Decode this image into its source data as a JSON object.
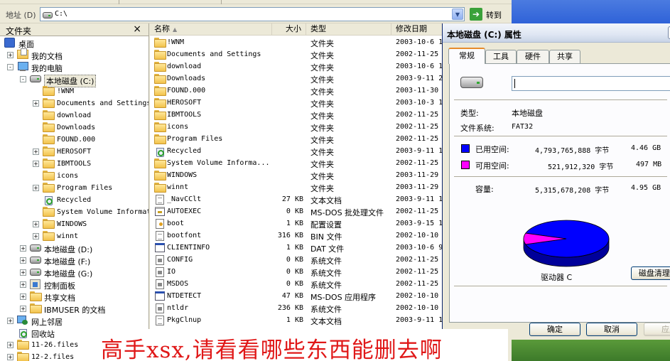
{
  "address_bar": {
    "label": "地址 (D)",
    "path": "C:\\",
    "go_label": "转到"
  },
  "folder_pane": {
    "title": "文件夹",
    "close": "×",
    "tree": [
      {
        "label": "桌面",
        "icon": "desktop-icon",
        "indent": 0,
        "exp": ""
      },
      {
        "label": "我的文档",
        "icon": "my-documents-icon",
        "indent": 1,
        "exp": "+"
      },
      {
        "label": "我的电脑",
        "icon": "my-computer-icon",
        "indent": 1,
        "exp": "-"
      },
      {
        "label": "本地磁盘 (C:)",
        "icon": "drive-icon",
        "indent": 2,
        "exp": "-",
        "selected": true
      },
      {
        "label": "!WNM",
        "icon": "folder-icon",
        "indent": 3,
        "exp": "",
        "mono": true
      },
      {
        "label": "Documents and Settings",
        "icon": "folder-icon",
        "indent": 3,
        "exp": "+",
        "mono": true
      },
      {
        "label": "download",
        "icon": "folder-icon",
        "indent": 3,
        "exp": "",
        "mono": true
      },
      {
        "label": "Downloads",
        "icon": "folder-icon",
        "indent": 3,
        "exp": "",
        "mono": true
      },
      {
        "label": "FOUND.000",
        "icon": "folder-icon",
        "indent": 3,
        "exp": "",
        "mono": true
      },
      {
        "label": "HEROSOFT",
        "icon": "folder-icon",
        "indent": 3,
        "exp": "+",
        "mono": true
      },
      {
        "label": "IBMTOOLS",
        "icon": "folder-icon",
        "indent": 3,
        "exp": "+",
        "mono": true
      },
      {
        "label": "icons",
        "icon": "folder-icon",
        "indent": 3,
        "exp": "",
        "mono": true
      },
      {
        "label": "Program Files",
        "icon": "folder-icon",
        "indent": 3,
        "exp": "+",
        "mono": true
      },
      {
        "label": "Recycled",
        "icon": "recycle-bin-icon",
        "indent": 3,
        "exp": "",
        "mono": true
      },
      {
        "label": "System Volume Information",
        "icon": "folder-icon",
        "indent": 3,
        "exp": "",
        "mono": true
      },
      {
        "label": "WINDOWS",
        "icon": "folder-icon",
        "indent": 3,
        "exp": "+",
        "mono": true
      },
      {
        "label": "winnt",
        "icon": "folder-icon",
        "indent": 3,
        "exp": "+",
        "mono": true
      },
      {
        "label": "本地磁盘 (D:)",
        "icon": "drive-icon",
        "indent": 2,
        "exp": "+"
      },
      {
        "label": "本地磁盘 (F:)",
        "icon": "drive-icon",
        "indent": 2,
        "exp": "+"
      },
      {
        "label": "本地磁盘 (G:)",
        "icon": "drive-icon",
        "indent": 2,
        "exp": "+"
      },
      {
        "label": "控制面板",
        "icon": "control-panel-icon",
        "indent": 2,
        "exp": "+"
      },
      {
        "label": "共享文档",
        "icon": "folder-icon",
        "indent": 2,
        "exp": "+"
      },
      {
        "label": "IBMUSER 的文档",
        "icon": "folder-icon",
        "indent": 2,
        "exp": "+"
      },
      {
        "label": "网上邻居",
        "icon": "network-icon",
        "indent": 1,
        "exp": "+"
      },
      {
        "label": "回收站",
        "icon": "recycle-bin-icon",
        "indent": 1,
        "exp": ""
      },
      {
        "label": "11-26.files",
        "icon": "folder-icon",
        "indent": 1,
        "exp": "+",
        "mono": true
      },
      {
        "label": "12-2.files",
        "icon": "folder-icon",
        "indent": 1,
        "exp": "+",
        "mono": true
      }
    ]
  },
  "file_list": {
    "columns": {
      "name": "名称",
      "size": "大小",
      "type": "类型",
      "date": "修改日期"
    },
    "rows": [
      {
        "name": "!WNM",
        "size": "",
        "type": "文件夹",
        "date": "2003-10-6 1",
        "icon": "folder-icon"
      },
      {
        "name": "Documents and Settings",
        "size": "",
        "type": "文件夹",
        "date": "2002-11-25",
        "icon": "folder-icon"
      },
      {
        "name": "download",
        "size": "",
        "type": "文件夹",
        "date": "2003-10-6 1",
        "icon": "folder-icon"
      },
      {
        "name": "Downloads",
        "size": "",
        "type": "文件夹",
        "date": "2003-9-11 2",
        "icon": "folder-icon"
      },
      {
        "name": "FOUND.000",
        "size": "",
        "type": "文件夹",
        "date": "2003-11-30",
        "icon": "folder-icon"
      },
      {
        "name": "HEROSOFT",
        "size": "",
        "type": "文件夹",
        "date": "2003-10-3 1",
        "icon": "folder-icon"
      },
      {
        "name": "IBMTOOLS",
        "size": "",
        "type": "文件夹",
        "date": "2002-11-25",
        "icon": "folder-icon"
      },
      {
        "name": "icons",
        "size": "",
        "type": "文件夹",
        "date": "2002-11-25",
        "icon": "folder-icon"
      },
      {
        "name": "Program Files",
        "size": "",
        "type": "文件夹",
        "date": "2002-11-25",
        "icon": "folder-icon"
      },
      {
        "name": "Recycled",
        "size": "",
        "type": "文件夹",
        "date": "2003-9-11 1",
        "icon": "recycle-bin-icon"
      },
      {
        "name": "System Volume Informa...",
        "size": "",
        "type": "文件夹",
        "date": "2002-11-25",
        "icon": "folder-icon"
      },
      {
        "name": "WINDOWS",
        "size": "",
        "type": "文件夹",
        "date": "2003-11-29",
        "icon": "folder-icon"
      },
      {
        "name": "winnt",
        "size": "",
        "type": "文件夹",
        "date": "2003-11-29",
        "icon": "folder-icon"
      },
      {
        "name": "_NavCClt",
        "size": "27 KB",
        "type": "文本文档",
        "date": "2003-9-11 1",
        "icon": "text-file-icon"
      },
      {
        "name": "AUTOEXEC",
        "size": "0 KB",
        "type": "MS-DOS 批处理文件",
        "date": "2002-11-25",
        "icon": "batch-file-icon"
      },
      {
        "name": "boot",
        "size": "1 KB",
        "type": "配置设置",
        "date": "2003-9-15 1",
        "icon": "config-file-icon"
      },
      {
        "name": "bootfont",
        "size": "316 KB",
        "type": "BIN 文件",
        "date": "2002-10-10",
        "icon": "bin-file-icon"
      },
      {
        "name": "CLIENTINFO",
        "size": "1 KB",
        "type": "DAT 文件",
        "date": "2003-10-6 9",
        "icon": "dat-file-icon"
      },
      {
        "name": "CONFIG",
        "size": "0 KB",
        "type": "系统文件",
        "date": "2002-11-25",
        "icon": "system-file-icon"
      },
      {
        "name": "IO",
        "size": "0 KB",
        "type": "系统文件",
        "date": "2002-11-25",
        "icon": "system-file-icon"
      },
      {
        "name": "MSDOS",
        "size": "0 KB",
        "type": "系统文件",
        "date": "2002-11-25",
        "icon": "system-file-icon"
      },
      {
        "name": "NTDETECT",
        "size": "47 KB",
        "type": "MS-DOS 应用程序",
        "date": "2002-10-10",
        "icon": "exe-file-icon"
      },
      {
        "name": "ntldr",
        "size": "236 KB",
        "type": "系统文件",
        "date": "2002-10-10",
        "icon": "system-file-icon"
      },
      {
        "name": "PkgClnup",
        "size": "1 KB",
        "type": "文本文档",
        "date": "2003-9-11 1",
        "icon": "text-file-icon"
      }
    ]
  },
  "properties": {
    "title": "本地磁盘 (C:) 属性",
    "tabs": [
      "常规",
      "工具",
      "硬件",
      "共享"
    ],
    "volume_label": "",
    "type_label": "类型:",
    "type_value": "本地磁盘",
    "fs_label": "文件系统:",
    "fs_value": "FAT32",
    "used_label": "已用空间:",
    "used_bytes": "4,793,765,888 字节",
    "used_gb": "4.46 GB",
    "free_label": "可用空间:",
    "free_bytes": "521,912,320 字节",
    "free_mb": "497 MB",
    "capacity_label": "容量:",
    "capacity_bytes": "5,315,678,208 字节",
    "capacity_gb": "4.95 GB",
    "used_fraction": 0.9018,
    "drive_caption": "驱动器 C",
    "cleanup_button": "磁盘清理(",
    "ok_button": "确定",
    "cancel_button": "取消",
    "apply_button": "应用",
    "colors": {
      "used": "#0000ff",
      "free": "#ff00ff"
    }
  },
  "caption": "高手xsx,请看看哪些东西能删去啊"
}
